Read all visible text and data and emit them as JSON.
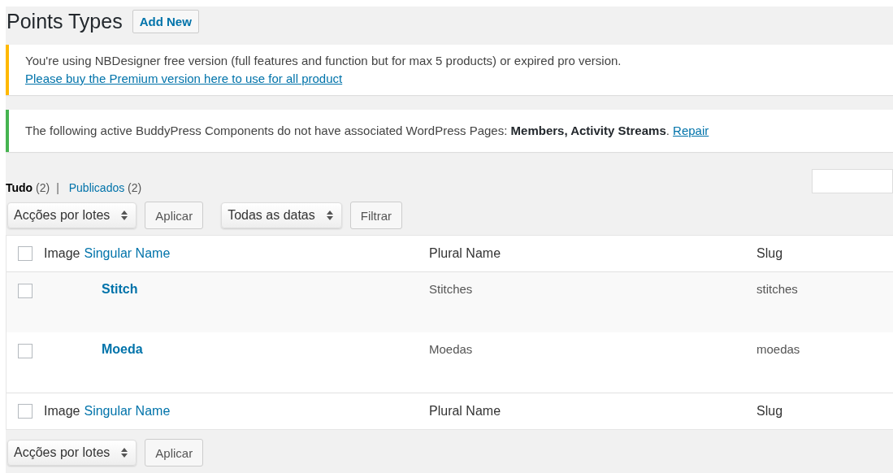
{
  "page": {
    "title": "Points Types",
    "add_new": "Add New"
  },
  "notices": [
    {
      "kind": "warning",
      "text": "You're using NBDesigner free version (full features and function but for max 5 products) or expired pro version.",
      "link": "Please buy the Premium version here to use for all product",
      "link_inline": false
    },
    {
      "kind": "success",
      "text": "The following active BuddyPress Components do not have associated WordPress Pages: **Members, Activity Streams**.",
      "link": "Repair",
      "link_inline": true
    }
  ],
  "views": [
    {
      "label": "Tudo",
      "count": "(2)",
      "selected": true
    },
    {
      "label": "Publicados",
      "count": "(2)",
      "selected": false
    }
  ],
  "views_separator": "|",
  "top_actions": {
    "bulk": "Acções por lotes",
    "apply": "Aplicar",
    "dates": "Todas as datas",
    "filter": "Filtrar"
  },
  "table": {
    "header": {
      "checked": false,
      "columns": [
        "Image",
        "Singular Name",
        "Plural Name",
        "Slug"
      ]
    },
    "rows": [
      {
        "checked": false,
        "name": "Stitch",
        "plural": "Stitches",
        "slug": "stitches"
      },
      {
        "checked": false,
        "name": "Moeda",
        "plural": "Moedas",
        "slug": "moedas"
      }
    ],
    "footer": {
      "checked": false,
      "columns": [
        "Image",
        "Singular Name",
        "Plural Name",
        "Slug"
      ]
    }
  },
  "bottom_actions": {
    "bulk": "Acções por lotes",
    "apply": "Aplicar"
  }
}
